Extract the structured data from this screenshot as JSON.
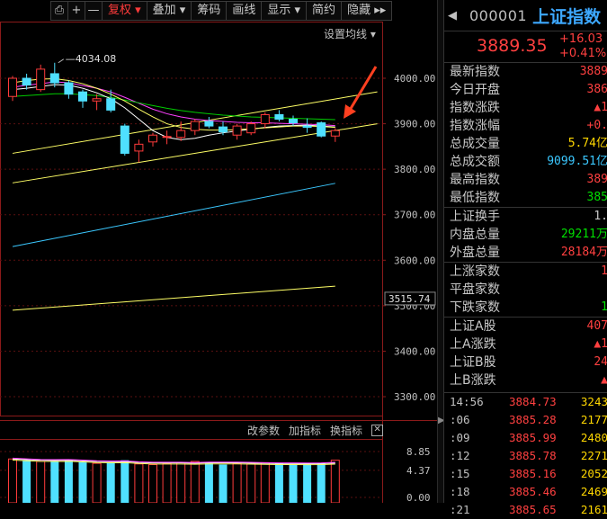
{
  "toolbar": {
    "items": [
      {
        "label": "复权 ▾",
        "active": true
      },
      {
        "label": "叠加 ▾",
        "active": false
      },
      {
        "label": "筹码",
        "active": false
      },
      {
        "label": "画线",
        "active": false
      },
      {
        "label": "显示 ▾",
        "active": false
      },
      {
        "label": "简约",
        "active": false
      },
      {
        "label": "隐藏 ▸▸",
        "active": false
      }
    ],
    "icons": {
      "screenshot": "⎙",
      "plus": "+",
      "minus": "—"
    }
  },
  "ma_setting_label": "设置均线 ▾",
  "peak_label": "4034.08",
  "price_axis": {
    "labels": [
      "4000.00",
      "3900.00",
      "3800.00",
      "3700.00",
      "3600.00",
      "3500.00",
      "3400.00",
      "3300.00"
    ],
    "current_marker": "3515.74"
  },
  "volume_axis": {
    "labels": [
      "8.85",
      "4.37",
      "0.00"
    ]
  },
  "indicator_buttons": {
    "params": "改参数",
    "add": "加指标",
    "switch": "换指标",
    "close": "✕"
  },
  "chart_data": {
    "type": "candlestick",
    "candles": [
      {
        "o": 3960,
        "h": 4005,
        "l": 3950,
        "c": 4000
      },
      {
        "o": 4000,
        "h": 4010,
        "l": 3975,
        "c": 3985
      },
      {
        "o": 3975,
        "h": 4030,
        "l": 3970,
        "c": 4020
      },
      {
        "o": 4010,
        "h": 4034.08,
        "l": 3980,
        "c": 3990
      },
      {
        "o": 3990,
        "h": 3995,
        "l": 3955,
        "c": 3965
      },
      {
        "o": 3970,
        "h": 3975,
        "l": 3935,
        "c": 3950
      },
      {
        "o": 3950,
        "h": 3965,
        "l": 3930,
        "c": 3955
      },
      {
        "o": 3955,
        "h": 3975,
        "l": 3925,
        "c": 3930
      },
      {
        "o": 3895,
        "h": 3900,
        "l": 3830,
        "c": 3835
      },
      {
        "o": 3840,
        "h": 3865,
        "l": 3815,
        "c": 3855
      },
      {
        "o": 3860,
        "h": 3880,
        "l": 3850,
        "c": 3875
      },
      {
        "o": 3870,
        "h": 3885,
        "l": 3855,
        "c": 3872
      },
      {
        "o": 3870,
        "h": 3905,
        "l": 3862,
        "c": 3885
      },
      {
        "o": 3885,
        "h": 3910,
        "l": 3875,
        "c": 3905
      },
      {
        "o": 3905,
        "h": 3915,
        "l": 3890,
        "c": 3895
      },
      {
        "o": 3893,
        "h": 3905,
        "l": 3875,
        "c": 3882
      },
      {
        "o": 3875,
        "h": 3900,
        "l": 3865,
        "c": 3895
      },
      {
        "o": 3880,
        "h": 3905,
        "l": 3875,
        "c": 3900
      },
      {
        "o": 3900,
        "h": 3925,
        "l": 3890,
        "c": 3920
      },
      {
        "o": 3920,
        "h": 3930,
        "l": 3905,
        "c": 3910
      },
      {
        "o": 3910,
        "h": 3918,
        "l": 3895,
        "c": 3902
      },
      {
        "o": 3895,
        "h": 3912,
        "l": 3880,
        "c": 3892
      },
      {
        "o": 3902,
        "h": 3905,
        "l": 3870,
        "c": 3873
      },
      {
        "o": 3873,
        "h": 3890,
        "l": 3860,
        "c": 3885
      }
    ],
    "volumes": [
      6.2,
      6.0,
      5.8,
      5.9,
      6.1,
      5.7,
      5.5,
      5.6,
      6.0,
      5.4,
      5.3,
      5.5,
      5.6,
      5.8,
      5.7,
      5.3,
      5.5,
      5.4,
      5.6,
      5.5,
      5.3,
      5.4,
      5.5,
      6.0
    ],
    "ma_lines": [
      {
        "color": "#ff40ff",
        "values": [
          3980,
          3985,
          3988,
          3992,
          3990,
          3984,
          3978,
          3970,
          3958,
          3945,
          3932,
          3922,
          3915,
          3910,
          3907,
          3905,
          3903,
          3902,
          3902,
          3901,
          3900,
          3899,
          3898,
          3896
        ]
      },
      {
        "color": "#00cc00",
        "values": [
          3960,
          3962,
          3964,
          3966,
          3966,
          3964,
          3962,
          3958,
          3952,
          3946,
          3940,
          3934,
          3929,
          3925,
          3922,
          3919,
          3917,
          3915,
          3914,
          3913,
          3912,
          3911,
          3910,
          3909
        ]
      },
      {
        "color": "#ffffff",
        "values": [
          3975,
          3978,
          3982,
          3986,
          3985,
          3978,
          3968,
          3955,
          3935,
          3910,
          3885,
          3870,
          3865,
          3868,
          3875,
          3880,
          3884,
          3888,
          3892,
          3895,
          3896,
          3897,
          3895,
          3893
        ]
      },
      {
        "color": "#ffff66",
        "values": [
          3990,
          3995,
          3998,
          3999,
          3995,
          3988,
          3978,
          3965,
          3950,
          3932,
          3915,
          3900,
          3892,
          3888,
          3886,
          3886,
          3887,
          3889,
          3891,
          3893,
          3895,
          3895,
          3894,
          3892
        ]
      }
    ],
    "trend_lines": [
      {
        "color": "#ffff66",
        "from": [
          0,
          3835
        ],
        "to": [
          26,
          3970
        ]
      },
      {
        "color": "#ffff66",
        "from": [
          0,
          3770
        ],
        "to": [
          26,
          3900
        ]
      },
      {
        "color": "#3bc8ff",
        "from": [
          0,
          3630
        ],
        "to": [
          23,
          3769
        ]
      },
      {
        "color": "#ffff66",
        "from": [
          0,
          3490
        ],
        "to": [
          23,
          3543
        ]
      }
    ]
  },
  "side": {
    "back_icon": "◀",
    "code": "000001",
    "name": "上证指数",
    "price": "3889.35",
    "change": "+16.03",
    "change_pct": "+0.41%",
    "rows": [
      {
        "label": "最新指数",
        "value": "3889",
        "color": "#ff4040"
      },
      {
        "label": "今日开盘",
        "value": "386",
        "color": "#ff4040"
      },
      {
        "label": "指数涨跌",
        "value": "▲1",
        "color": "#ff4040"
      },
      {
        "label": "指数涨幅",
        "value": "+0.",
        "color": "#ff4040"
      },
      {
        "label": "总成交量",
        "value": "5.74亿",
        "color": "#ffd700"
      },
      {
        "label": "总成交额",
        "value": "9099.51亿",
        "color": "#3bc8ff"
      },
      {
        "label": "最高指数",
        "value": "389",
        "color": "#ff4040"
      },
      {
        "label": "最低指数",
        "value": "385",
        "color": "#00e000"
      },
      {
        "label": "上证换手",
        "value": "1.",
        "color": "#c8c8c8",
        "sep": true
      },
      {
        "label": "内盘总量",
        "value": "29211万",
        "color": "#00e000"
      },
      {
        "label": "外盘总量",
        "value": "28184万",
        "color": "#ff4040"
      },
      {
        "label": "上涨家数",
        "value": "1",
        "color": "#ff4040",
        "sep": true
      },
      {
        "label": "平盘家数",
        "value": "",
        "color": "#c8c8c8"
      },
      {
        "label": "下跌家数",
        "value": "1",
        "color": "#00e000"
      },
      {
        "label": "上证A股",
        "value": "407",
        "color": "#ff4040",
        "sep": true
      },
      {
        "label": "上A涨跌",
        "value": "▲1",
        "color": "#ff4040"
      },
      {
        "label": "上证B股",
        "value": "24",
        "color": "#ff4040"
      },
      {
        "label": "上B涨跌",
        "value": "▲",
        "color": "#ff4040"
      }
    ],
    "ticks": [
      {
        "time": "14:56",
        "price": "3884.73",
        "vol": "3243"
      },
      {
        "time": ":06",
        "price": "3885.28",
        "vol": "2177"
      },
      {
        "time": ":09",
        "price": "3885.99",
        "vol": "2480"
      },
      {
        "time": ":12",
        "price": "3885.78",
        "vol": "2271"
      },
      {
        "time": ":15",
        "price": "3885.16",
        "vol": "2052"
      },
      {
        "time": ":18",
        "price": "3885.46",
        "vol": "2469"
      },
      {
        "time": ":21",
        "price": "3885.65",
        "vol": "2161"
      }
    ]
  },
  "annotation": {
    "color": "#ff4020"
  }
}
